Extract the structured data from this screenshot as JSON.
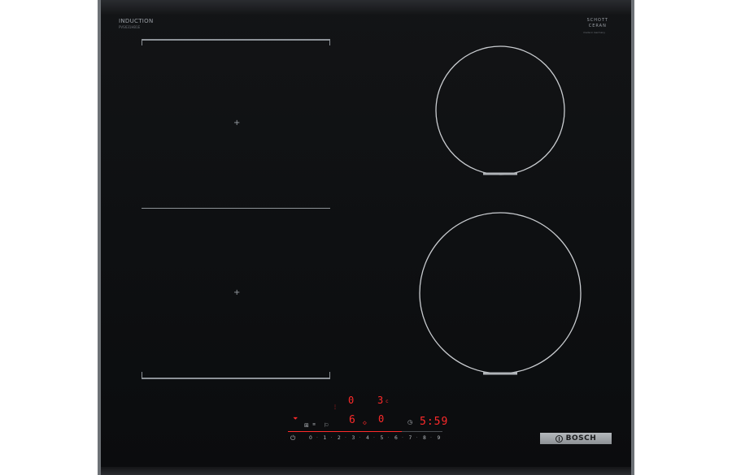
{
  "panel": {
    "label_induction": "INDUCTION",
    "label_model": "PVS631HB1E",
    "label_schott_top": "SCHOTT",
    "label_schott_bottom": "CERAN",
    "label_schott_sub": "made in Germany"
  },
  "displays": {
    "upper_zone_left": "0",
    "upper_zone_right": "3",
    "upper_zone_right_sub": "c",
    "lower_zone_left": "6",
    "lower_zone_right": "0",
    "timer": "5:59"
  },
  "power_scale": [
    "0",
    "1",
    "2",
    "3",
    "4",
    "5",
    "6",
    "7",
    "8",
    "9"
  ],
  "brand": {
    "name": "BOSCH"
  },
  "colors": {
    "display_red": "#ff2a2a",
    "glass": "#0e1012",
    "frame": "#6d7176"
  }
}
